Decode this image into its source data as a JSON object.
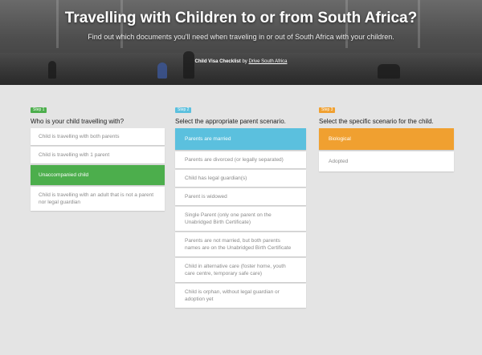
{
  "hero": {
    "title": "Travelling with Children to or from South Africa?",
    "subtitle": "Find out which documents you'll need when traveling in or out of South Africa with your children.",
    "credit_title": "Child Visa Checklist",
    "credit_by": "by",
    "credit_link": "Drive South Africa"
  },
  "steps": [
    {
      "badge": "Step 1",
      "badge_color": "#4cae4c",
      "question": "Who is your child travelling with?",
      "options": [
        {
          "label": "Child is travelling with both parents",
          "selected": false
        },
        {
          "label": "Child is travelling with 1 parent",
          "selected": false
        },
        {
          "label": "Unaccompanied child",
          "selected": true
        },
        {
          "label": "Child is travelling with an adult that is not a parent nor legal guardian",
          "selected": false
        }
      ]
    },
    {
      "badge": "Step 2",
      "badge_color": "#5bc0de",
      "question": "Select the appropriate parent scenario.",
      "options": [
        {
          "label": "Parents are married",
          "selected": true
        },
        {
          "label": "Parents are divorced (or legally separated)",
          "selected": false
        },
        {
          "label": "Child has legal guardian(s)",
          "selected": false
        },
        {
          "label": "Parent is widowed",
          "selected": false
        },
        {
          "label": "Single Parent (only one parent on the Unabridged Birth Certificate)",
          "selected": false
        },
        {
          "label": "Parents are not married, but both parents names are on the Unabridged Birth Certificate",
          "selected": false
        },
        {
          "label": "Child in alternative care (foster home, youth care centre, temporary safe care)",
          "selected": false
        },
        {
          "label": "Child is orphan, without legal guardian or adoption yet",
          "selected": false
        }
      ]
    },
    {
      "badge": "Step 3",
      "badge_color": "#f0a030",
      "question": "Select the specific scenario for the child.",
      "options": [
        {
          "label": "Biological",
          "selected": true
        },
        {
          "label": "Adopted",
          "selected": false
        }
      ]
    }
  ]
}
